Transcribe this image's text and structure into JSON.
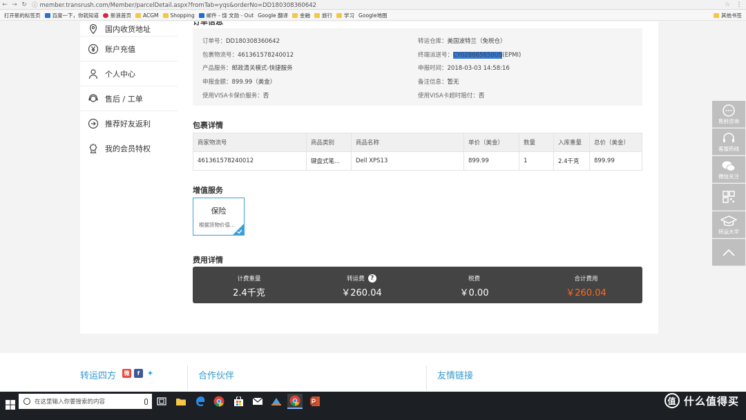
{
  "browser": {
    "url": "member.transrush.com/Member/parcelDetail.aspx?fromTab=yqs&orderNo=DD180308360642",
    "bookmarks": [
      "打开新的标签页",
      "百度一下，你就知道",
      "新浪首页",
      "ACGM",
      "Shopping",
      "邮件 - 饶 文勋 - Out",
      "Google 翻译",
      "金融",
      "旅行",
      "学习",
      "Google地图"
    ],
    "bookmarks_other": "其他书签"
  },
  "sidebar": {
    "items": [
      {
        "label": "国内收货地址",
        "icon": "location-pin-icon"
      },
      {
        "label": "账户充值",
        "icon": "yen-icon"
      },
      {
        "label": "个人中心",
        "icon": "user-icon"
      },
      {
        "label": "售后 / 工单",
        "icon": "headset-icon"
      },
      {
        "label": "推荐好友返利",
        "icon": "refer-icon"
      },
      {
        "label": "我的会员特权",
        "icon": "badge-icon"
      }
    ]
  },
  "order": {
    "title": "订单信息",
    "left": [
      {
        "k": "订单号：",
        "v": "DD180308360642"
      },
      {
        "k": "包裹物流号：",
        "v": "461361578240012"
      },
      {
        "k": "产品服务：",
        "v": "邮政清关模式-快捷服务"
      },
      {
        "k": "申报金额：",
        "v": "899.99（美金）"
      },
      {
        "k": "使用VISA卡保价服务：",
        "v": "否"
      }
    ],
    "right": [
      {
        "k": "转运仓库：",
        "v": "美国波特兰（免税仓）"
      },
      {
        "k": "终端派送号：",
        "v": "CY028665650US",
        "suffix": "(EPMI)"
      },
      {
        "k": "申报时间：",
        "v": "2018-03-03 14:58:16"
      },
      {
        "k": "备注信息：",
        "v": "暂无"
      },
      {
        "k": "使用VISA卡超时赔付：",
        "v": "否"
      }
    ]
  },
  "parcel": {
    "title": "包裹详情",
    "headers": [
      "商家物流号",
      "商品类别",
      "商品名称",
      "单价（美金）",
      "数量",
      "入库重量",
      "总价（美金）"
    ],
    "rows": [
      [
        "461361578240012",
        "键盘式笔...",
        "Dell XPS13",
        "899.99",
        "1",
        "2.4千克",
        "899.99"
      ]
    ]
  },
  "vas": {
    "title": "增值服务",
    "name": "保险",
    "desc": "根据货物价值..."
  },
  "fees": {
    "title": "费用详情",
    "items": [
      {
        "label": "计费重量",
        "value": "2.4千克"
      },
      {
        "label": "转运费",
        "value": "￥260.04"
      },
      {
        "label": "税费",
        "value": "￥0.00"
      },
      {
        "label": "合计费用",
        "value": "￥260.04"
      }
    ],
    "accent": "#ff6a1f"
  },
  "footer": {
    "cols": [
      "转运四方",
      "合作伙伴",
      "友情链接"
    ]
  },
  "floaters": [
    "售前咨询",
    "客服热线",
    "微信关注",
    "",
    "转运大学",
    ""
  ],
  "taskbar": {
    "search_placeholder": "在这里输入你要搜索的内容",
    "brand": "什么值得买",
    "brand_badge": "值"
  }
}
